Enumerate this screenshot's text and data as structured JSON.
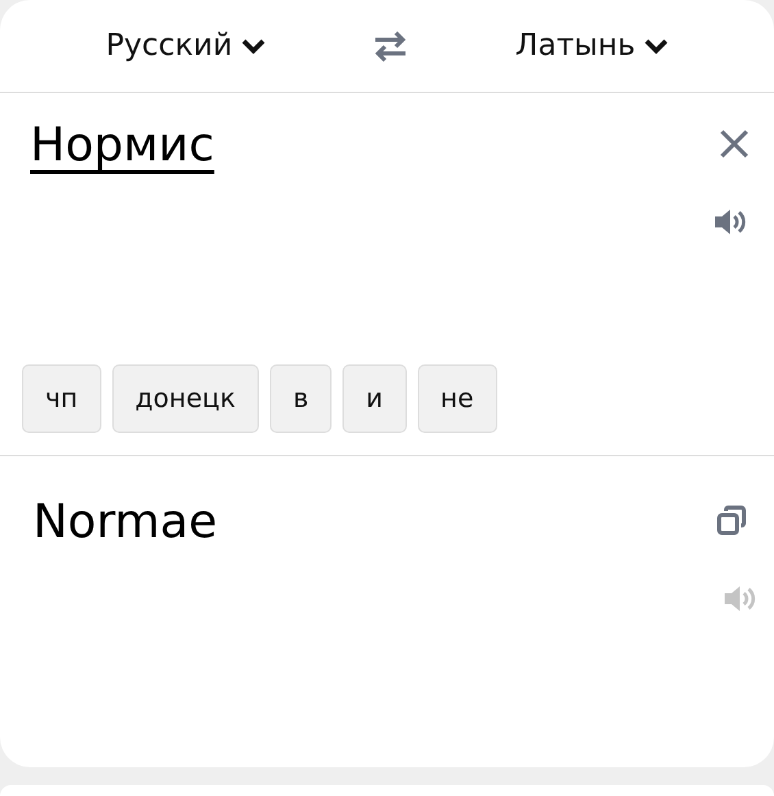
{
  "languages": {
    "source": "Русский",
    "target": "Латынь"
  },
  "source": {
    "text": "Нормис",
    "underlined": true,
    "speak_disabled": false
  },
  "suggestions": [
    {
      "label": "чп"
    },
    {
      "label": "донецк"
    },
    {
      "label": "в"
    },
    {
      "label": "и"
    },
    {
      "label": "не"
    }
  ],
  "translation": {
    "text": "Normae",
    "speak_disabled": true
  }
}
